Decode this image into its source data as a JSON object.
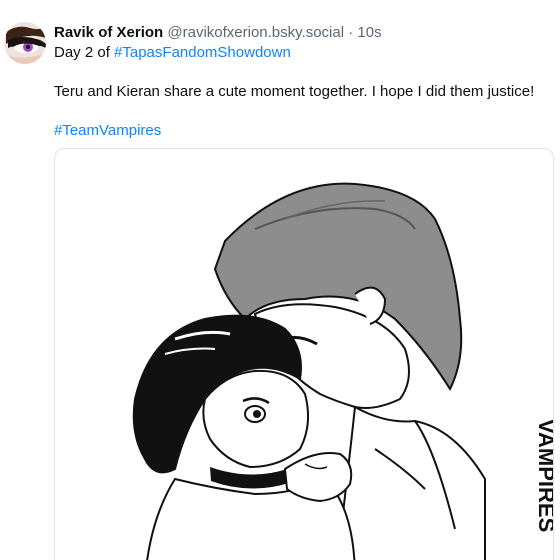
{
  "post": {
    "author_name": "Ravik of Xerion",
    "author_handle": "@ravikofxerion.bsky.social",
    "separator": "·",
    "timestamp": "10s",
    "line2_prefix": "Day 2 of ",
    "line2_hashtag": "#TapasFandomShowdown",
    "text": "Teru and Kieran share a cute moment together. I hope I did them justice!",
    "hashtag": "#TeamVampires",
    "image_signature": "VAMPIRES"
  },
  "colors": {
    "link": "#1083fe",
    "secondary_text": "#5b6775",
    "border": "#dfe3e8"
  },
  "icons": {
    "avatar": "user-avatar"
  }
}
